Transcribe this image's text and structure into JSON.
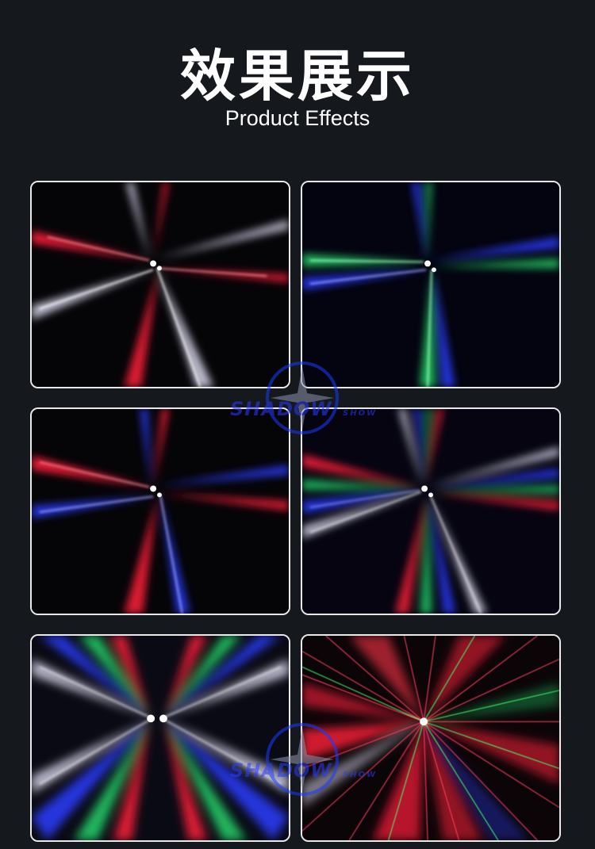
{
  "heading": {
    "title": "效果展示",
    "subtitle": "Product Effects"
  },
  "watermark": {
    "brand": "SHADOW",
    "tagline": "SHOW"
  },
  "gallery": [
    {
      "name": "effect-photo-1",
      "beams": [
        "red",
        "white"
      ]
    },
    {
      "name": "effect-photo-2",
      "beams": [
        "blue",
        "green"
      ]
    },
    {
      "name": "effect-photo-3",
      "beams": [
        "red",
        "blue"
      ]
    },
    {
      "name": "effect-photo-4",
      "beams": [
        "red",
        "green",
        "blue",
        "white"
      ]
    },
    {
      "name": "effect-photo-5",
      "beams": [
        "white",
        "blue",
        "green",
        "red"
      ]
    },
    {
      "name": "effect-photo-6",
      "beams": [
        "red",
        "green",
        "white",
        "laser-red"
      ]
    }
  ],
  "colors": {
    "background": "#15181c",
    "red": "#ff1f3a",
    "white": "#e8e8ff",
    "blue": "#2a3cff",
    "green": "#23d36a"
  }
}
